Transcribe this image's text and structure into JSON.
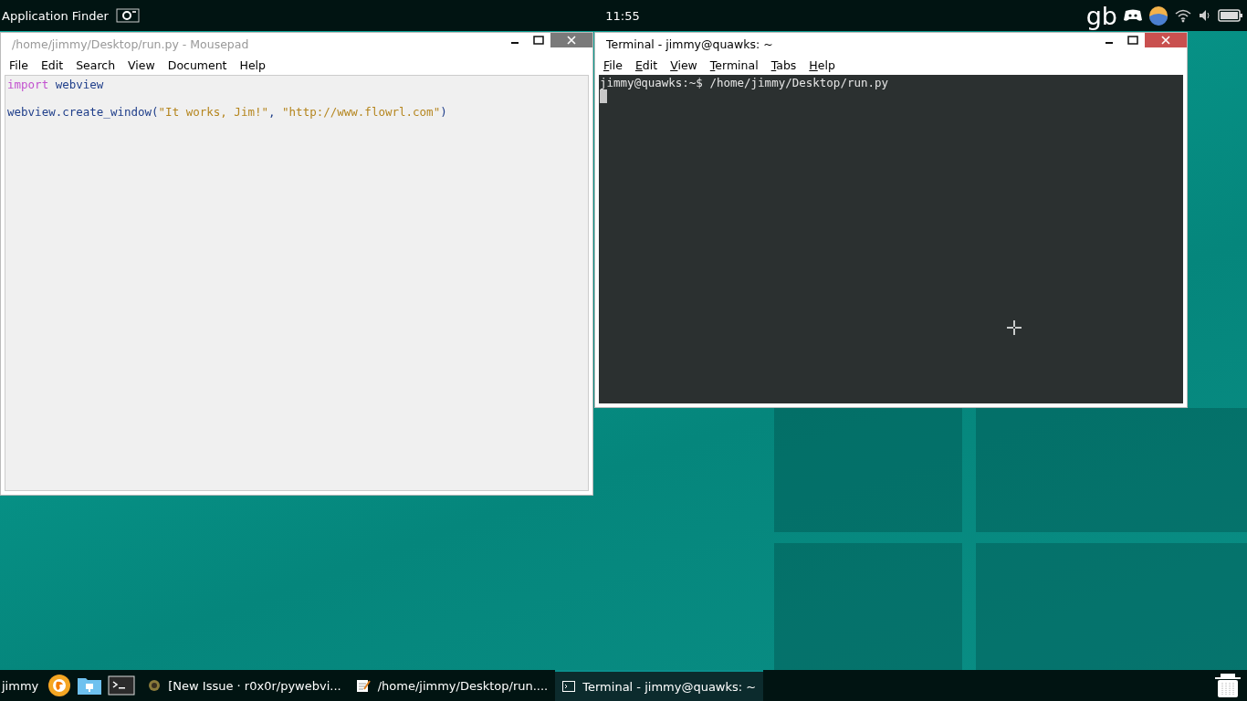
{
  "top_panel": {
    "app_finder": "Application Finder",
    "clock": "11:55",
    "keyboard_layout": "gb"
  },
  "windows": [
    {
      "kind": "editor",
      "title": "/home/jimmy/Desktop/run.py - Mousepad",
      "active": false,
      "menu": [
        {
          "label": "File"
        },
        {
          "label": "Edit"
        },
        {
          "label": "Search"
        },
        {
          "label": "View"
        },
        {
          "label": "Document"
        },
        {
          "label": "Help"
        }
      ],
      "mnemonics": false,
      "lines": [
        {
          "kind": "code",
          "tokens": [
            {
              "kind": "keyword",
              "text": "import"
            },
            {
              "kind": "plain",
              "text": " webview"
            }
          ]
        },
        {
          "kind": "blank"
        },
        {
          "kind": "code",
          "tokens": [
            {
              "kind": "plain",
              "text": "webview.create_window("
            },
            {
              "kind": "string",
              "text": "\"It works, Jim!\""
            },
            {
              "kind": "plain",
              "text": ", "
            },
            {
              "kind": "string",
              "text": "\"http://www.flowrl.com\""
            },
            {
              "kind": "plain",
              "text": ")"
            }
          ]
        }
      ]
    },
    {
      "kind": "terminal",
      "title": "Terminal - jimmy@quawks: ~",
      "active": true,
      "menu": [
        {
          "label": "File"
        },
        {
          "label": "Edit"
        },
        {
          "label": "View"
        },
        {
          "label": "Terminal"
        },
        {
          "label": "Tabs"
        },
        {
          "label": "Help"
        }
      ],
      "mnemonics": true,
      "lines": [
        {
          "kind": "code",
          "tokens": [
            {
              "kind": "plain",
              "text": "jimmy@quawks:~$ /home/jimmy/Desktop/run.py"
            }
          ]
        }
      ]
    }
  ],
  "taskbar": {
    "user": "jimmy",
    "tasks": [
      {
        "kind": "browser",
        "label": "[New Issue · r0x0r/pywebvi...",
        "selected": false
      },
      {
        "kind": "editor",
        "label": "/home/jimmy/Desktop/run....",
        "selected": false
      },
      {
        "kind": "terminal",
        "label": "Terminal - jimmy@quawks: ~",
        "selected": true
      }
    ]
  }
}
